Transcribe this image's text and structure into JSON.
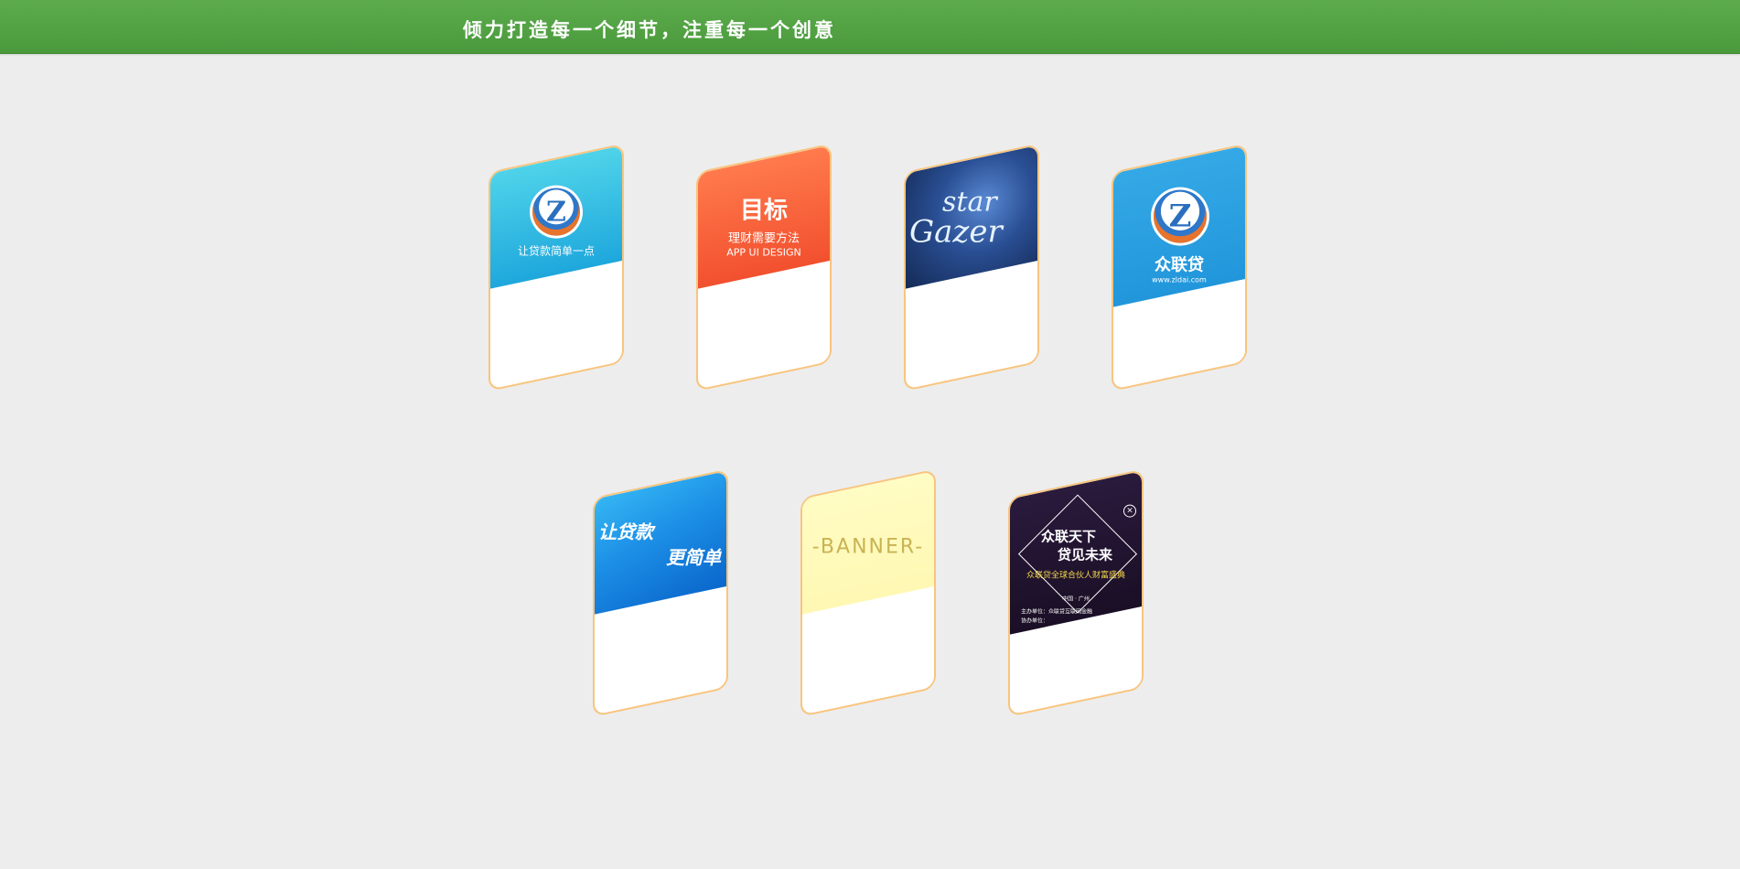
{
  "header": {
    "slogan": "倾力打造每一个细节，注重每一个创意"
  },
  "cards": [
    {
      "name": "card-loan-simple",
      "tagline": "让贷款简单一点",
      "colors": {
        "banner_top": "#4fd3ea",
        "banner_bottom": "#1ea7dc"
      }
    },
    {
      "name": "card-goal",
      "title": "目标",
      "subtitle": "理财需要方法",
      "caption": "APP UI DESIGN",
      "colors": {
        "banner_top": "#ff7a4d",
        "banner_bottom": "#f2502e"
      }
    },
    {
      "name": "card-stargazer",
      "word1": "star",
      "word2": "Gazer",
      "colors": {
        "banner_top": "#2f5ea8",
        "banner_bottom": "#162c5a"
      }
    },
    {
      "name": "card-zhonglian",
      "title": "众联贷",
      "url": "www.zldai.com",
      "colors": {
        "banner_top": "#35a9e6",
        "banner_bottom": "#2196db"
      }
    },
    {
      "name": "card-loan-simpler",
      "line1": "让贷款",
      "line2": "更简单",
      "colors": {
        "banner_top": "#1c97e8",
        "banner_bottom": "#0a6fd1"
      }
    },
    {
      "name": "card-banner",
      "label": "-BANNER-",
      "colors": {
        "banner_top": "#fffcc4",
        "banner_bottom": "#fff8b3",
        "text": "#c9b355"
      }
    },
    {
      "name": "card-event",
      "line1": "众联天下",
      "line2": "贷见未来",
      "line3": "众联贷全球合伙人财富盛典",
      "line4": "中国 · 广州",
      "line5": "主办单位：众联贷互联网金融",
      "line6": "协办单位：",
      "colors": {
        "banner_top": "#2a1a3c",
        "banner_bottom": "#1a0f26",
        "accent": "#f4d64a"
      }
    }
  ]
}
